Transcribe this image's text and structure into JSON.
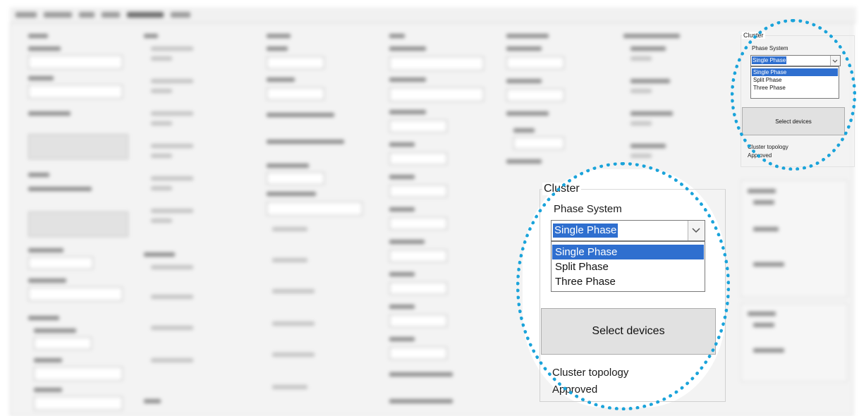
{
  "cluster": {
    "title": "Cluster",
    "phase_label": "Phase System",
    "selected": "Single Phase",
    "options": [
      "Single Phase",
      "Split Phase",
      "Three Phase"
    ],
    "select_button": "Select devices",
    "topology_label": "Cluster topology",
    "topology_status": "Approved"
  },
  "colors": {
    "highlight_ring": "#1aa3da",
    "selection": "#2f6fcf"
  },
  "icons": {
    "dropdown": "chevron-down-icon"
  }
}
